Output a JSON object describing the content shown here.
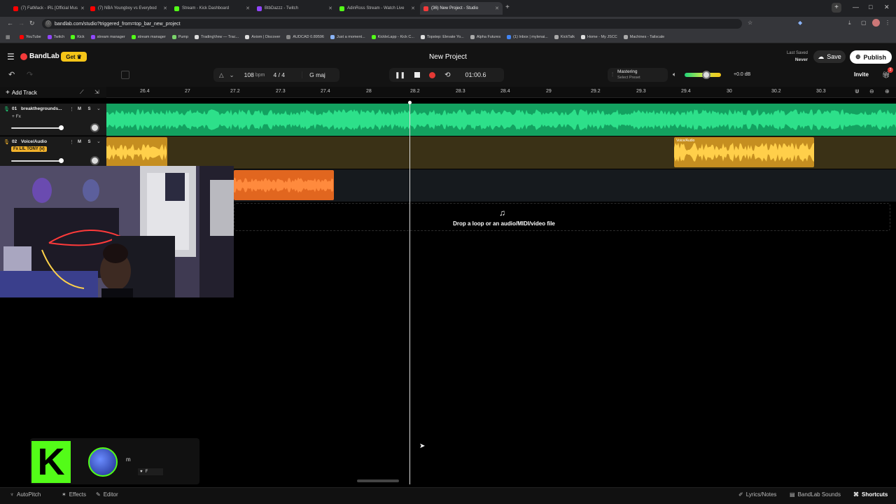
{
  "browser": {
    "tabs": [
      {
        "label": "(7) FatMack - IRL [Official Mus",
        "favicon_color": "#ff0000"
      },
      {
        "label": "(7) NBA Youngboy vs Everybod",
        "favicon_color": "#ff0000"
      },
      {
        "label": "Stream - Kick Dashboard",
        "favicon_color": "#53fc18"
      },
      {
        "label": "BtbDazzz - Twitch",
        "favicon_color": "#9146ff"
      },
      {
        "label": "AdinRoss Stream - Watch Live",
        "favicon_color": "#53fc18"
      },
      {
        "label": "(36) New Project - Studio",
        "favicon_color": "#f23a3a"
      }
    ],
    "url": "bandlab.com/studio?triggered_from=top_bar_new_project",
    "bookmarks": [
      "YouTube",
      "Twitch",
      "Kick",
      "stream manager",
      "stream manager",
      "Pump",
      "TradingView — Trac...",
      "Axiom | Discover",
      "AUDCAD 0.89596",
      "Just a moment...",
      "KickleLapp - Kick C...",
      "Topstep: Elevate Yo...",
      "Alpha Futures",
      "(1) Inbox | mylenai...",
      "KickTalk",
      "Home - My JSCC",
      "Machines - Tailscale"
    ]
  },
  "app": {
    "brand": "BandLab",
    "get_label": "Get",
    "project_title": "New Project",
    "last_saved_label": "Last Saved",
    "last_saved_value": "Never",
    "save_label": "Save",
    "publish_label": "Publish",
    "invite_label": "Invite",
    "notif_count": "3",
    "bpm": "108",
    "bpm_unit": "bpm",
    "time_sig": "4 / 4",
    "key": "G maj",
    "time": "01:00.6",
    "mastering_title": "Mastering",
    "mastering_preset": "Select Preset",
    "volume_db": "+0.0 dB",
    "volume_level": 0.6,
    "add_track_label": "Add Track",
    "ruler_ticks": [
      "26.4",
      "27",
      "27.2",
      "27.3",
      "27.4",
      "28",
      "28.2",
      "28.3",
      "28.4",
      "29",
      "29.2",
      "29.3",
      "29.4",
      "30",
      "30.2",
      "30.3"
    ],
    "tracks": [
      {
        "number": "01",
        "name": "breakthegrounds...",
        "fx": "+ Fx",
        "color": "#1ed47a"
      },
      {
        "number": "02",
        "name": "Voice/Audio",
        "fx": "Fx LIL TONY (v)",
        "color": "#f0b12b"
      }
    ],
    "region_label": "Voice/Audio",
    "drop_text": "Drop a loop or an audio/MIDI/video file",
    "bottom_left": [
      "AutoPitch",
      "Effects",
      "Editor"
    ],
    "bottom_right": [
      "Lyrics/Notes",
      "BandLab Sounds",
      "Shortcuts"
    ]
  },
  "overlay": {
    "kick_logo": "K",
    "chat_letter": "m",
    "chat_small": "F"
  }
}
